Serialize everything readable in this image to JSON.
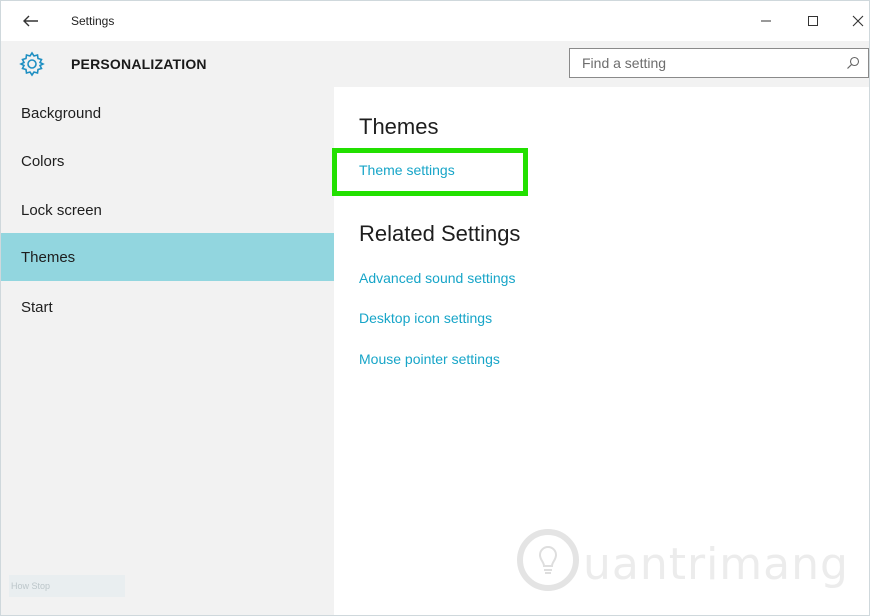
{
  "window": {
    "title": "Settings",
    "controls": {
      "minimize": "—",
      "maximize": "☐",
      "close": "✕"
    }
  },
  "header": {
    "title": "PERSONALIZATION",
    "search": {
      "placeholder": "Find a setting",
      "value": ""
    }
  },
  "sidebar": {
    "items": [
      {
        "label": "Background"
      },
      {
        "label": "Colors"
      },
      {
        "label": "Lock screen"
      },
      {
        "label": "Themes",
        "active": true
      },
      {
        "label": "Start"
      }
    ],
    "footer_faint": "How Stop"
  },
  "main": {
    "section_heading": "Themes",
    "theme_link": "Theme settings",
    "related_heading": "Related Settings",
    "related_links": [
      "Advanced sound settings",
      "Desktop icon settings",
      "Mouse pointer settings"
    ]
  },
  "watermark": {
    "text": "uantrimang"
  },
  "colors": {
    "accent_link": "#17a5c8",
    "active_nav": "#92d6df",
    "highlight": "#22e000",
    "sidebar_bg": "#f2f2f2"
  }
}
